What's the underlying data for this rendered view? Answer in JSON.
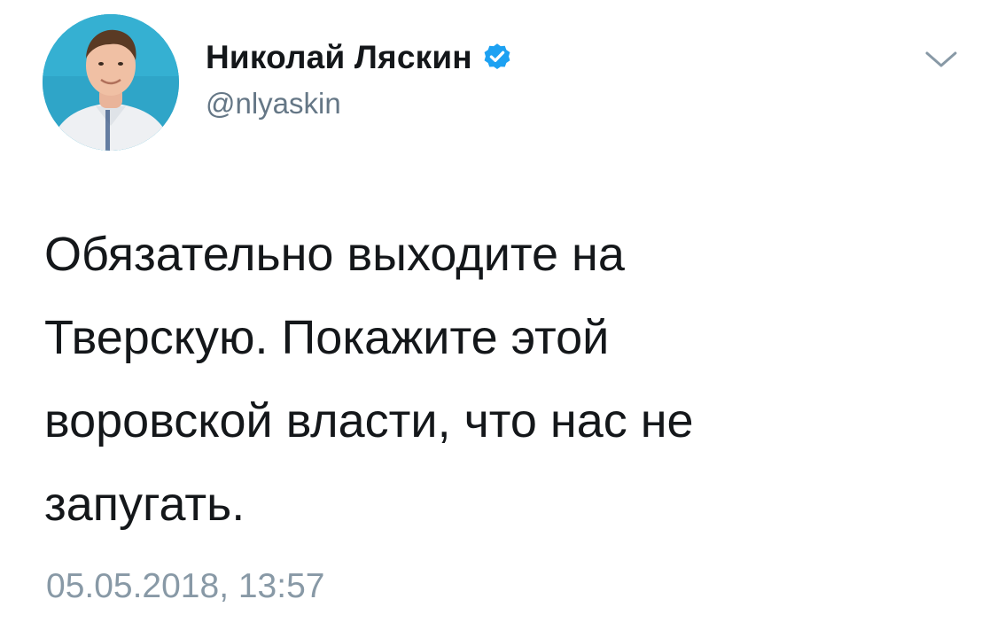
{
  "tweet": {
    "author": {
      "display_name": "Николай Ляскин",
      "handle": "@nlyaskin",
      "verified_icon": "verified-badge-icon",
      "avatar_icon": "profile-photo"
    },
    "menu_icon": "chevron-down-icon",
    "text": "Обязательно выходите на\nТверскую. Покажите этой\nворовской власти, что нас не\nзапугать.",
    "timestamp": "05.05.2018, 13:57"
  },
  "colors": {
    "text": "#14171a",
    "secondary": "#657786",
    "timestamp": "#8899a6",
    "verified": "#1da1f2",
    "avatar_bg": "#2fa5c8"
  }
}
